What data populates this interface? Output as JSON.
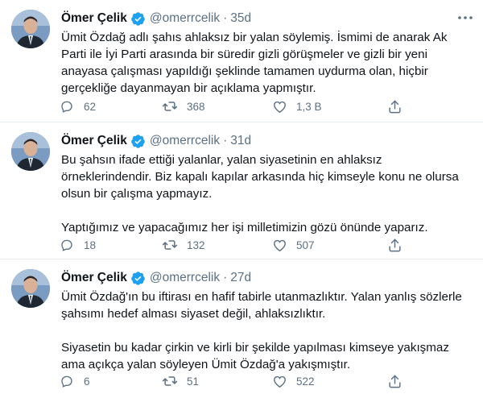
{
  "tweets": [
    {
      "name": "Ömer Çelik",
      "handle": "@omerrcelik",
      "dot": "·",
      "time": "35d",
      "paragraphs": [
        "Ümit Özdağ adlı şahıs ahlaksız bir yalan söylemiş. İsmimi de anarak Ak Parti ile İyi Parti arasında bir süredir gizli görüşmeler ve gizli bir yeni anayasa çalışması yapıldığı şeklinde tamamen uydurma olan, hiçbir gerçekliğe dayanmayan bir açıklama yapmıştır."
      ],
      "replies": "62",
      "retweets": "368",
      "likes": "1,3 B"
    },
    {
      "name": "Ömer Çelik",
      "handle": "@omerrcelik",
      "dot": "·",
      "time": "31d",
      "paragraphs": [
        "Bu şahsın ifade ettiği yalanlar, yalan siyasetinin en ahlaksız örneklerindendir. Biz kapalı kapılar arkasında hiç kimseyle konu ne olursa olsun bir çalışma yapmayız.",
        "Yaptığımız ve yapacağımız her işi milletimizin gözü önünde yaparız."
      ],
      "replies": "18",
      "retweets": "132",
      "likes": "507"
    },
    {
      "name": "Ömer Çelik",
      "handle": "@omerrcelik",
      "dot": "·",
      "time": "27d",
      "paragraphs": [
        "Ümit Özdağ'ın bu iftirası en hafif tabirle utanmazlıktır. Yalan yanlış sözlerle şahsımı hedef alması siyaset değil, ahlaksızlıktır.",
        "Siyasetin bu kadar çirkin ve kirli bir şekilde yapılması kimseye yakışmaz ama açıkça yalan söyleyen Ümit Özdağ'a yakışmıştır."
      ],
      "replies": "6",
      "retweets": "51",
      "likes": "522"
    }
  ],
  "icons": {
    "reply": "reply-icon",
    "retweet": "retweet-icon",
    "like": "heart-icon",
    "share": "share-icon",
    "more": "more-icon",
    "verified": "verified-badge-icon"
  },
  "colors": {
    "text": "#0f1419",
    "secondary": "#5b7083",
    "verified": "#1da1f2",
    "divider": "#e6ecf0"
  }
}
